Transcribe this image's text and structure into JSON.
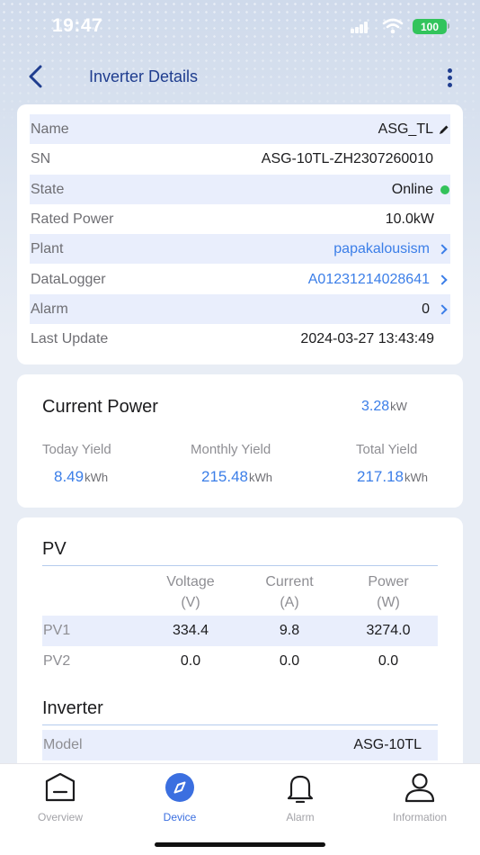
{
  "status_bar": {
    "time": "19:47",
    "battery": "100"
  },
  "header": {
    "title": "Inverter Details",
    "back_icon": "chevron-left-icon",
    "more_icon": "more-vertical-icon"
  },
  "details": {
    "rows": [
      {
        "label": "Name",
        "value": "ASG_TL"
      },
      {
        "label": "SN",
        "value": "ASG-10TL-ZH2307260010"
      },
      {
        "label": "State",
        "value": "Online"
      },
      {
        "label": "Rated Power",
        "value": "10.0kW"
      },
      {
        "label": "Plant",
        "value": "papakalousism"
      },
      {
        "label": "DataLogger",
        "value": "A01231214028641"
      },
      {
        "label": "Alarm",
        "value": "0"
      },
      {
        "label": "Last Update",
        "value": "2024-03-27 13:43:49"
      }
    ]
  },
  "power": {
    "title": "Current Power",
    "current_value": "3.28",
    "current_unit": "kW",
    "today_label": "Today Yield",
    "today_value": "8.49",
    "today_unit": "kWh",
    "monthly_label": "Monthly Yield",
    "monthly_value": "215.48",
    "monthly_unit": "kWh",
    "total_label": "Total Yield",
    "total_value": "217.18",
    "total_unit": "kWh"
  },
  "pv": {
    "title": "PV",
    "headers": [
      {
        "name": "Voltage",
        "unit": "(V)"
      },
      {
        "name": "Current",
        "unit": "(A)"
      },
      {
        "name": "Power",
        "unit": "(W)"
      }
    ],
    "rows": [
      {
        "label": "PV1",
        "voltage": "334.4",
        "current": "9.8",
        "power": "3274.0"
      },
      {
        "label": "PV2",
        "voltage": "0.0",
        "current": "0.0",
        "power": "0.0"
      }
    ]
  },
  "inverter": {
    "title": "Inverter",
    "model_label": "Model",
    "model_value": "ASG-10TL"
  },
  "tabs": [
    {
      "label": "Overview",
      "icon": "overview-icon",
      "active": false
    },
    {
      "label": "Device",
      "icon": "compass-icon",
      "active": true
    },
    {
      "label": "Alarm",
      "icon": "bell-icon",
      "active": false
    },
    {
      "label": "Information",
      "icon": "person-icon",
      "active": false
    }
  ],
  "colors": {
    "accent": "#3b7ee8",
    "title": "#1f3d8f",
    "online": "#33c25a",
    "row_shade": "#e9eefc"
  }
}
